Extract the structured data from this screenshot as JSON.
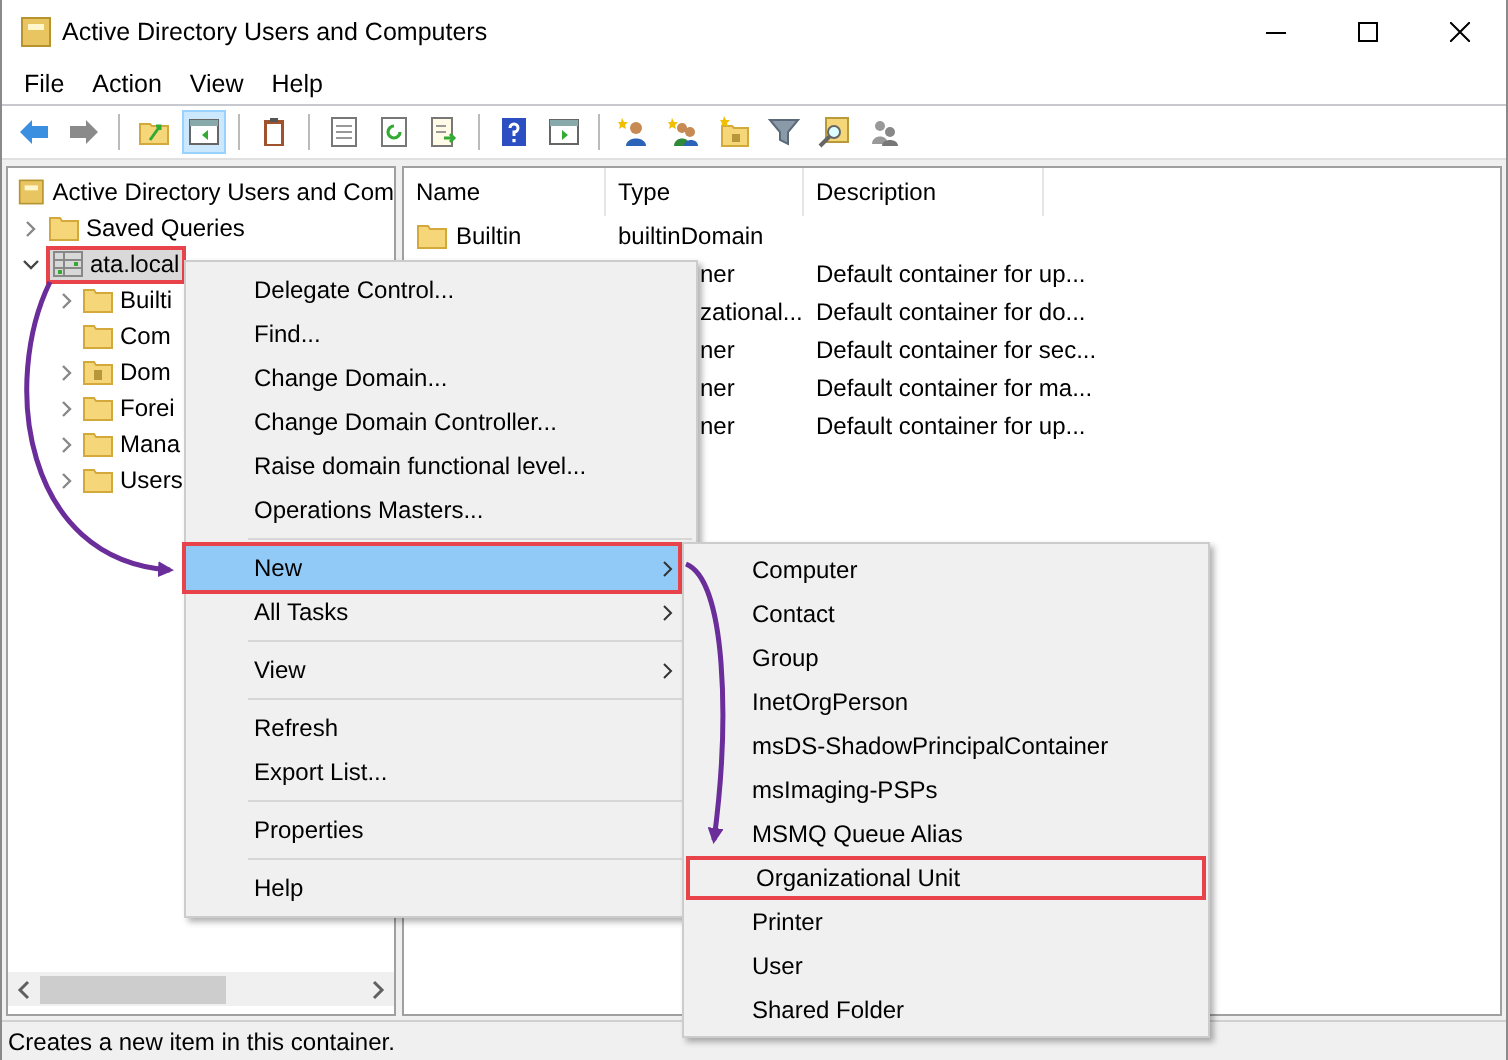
{
  "window": {
    "title": "Active Directory Users and Computers"
  },
  "menu_bar": [
    "File",
    "Action",
    "View",
    "Help"
  ],
  "toolbar": [
    {
      "kind": "back",
      "pressed": false
    },
    {
      "kind": "forward",
      "pressed": false
    },
    {
      "kind": "sep"
    },
    {
      "kind": "up",
      "pressed": false
    },
    {
      "kind": "tree",
      "pressed": true
    },
    {
      "kind": "sep"
    },
    {
      "kind": "clipboard",
      "pressed": false
    },
    {
      "kind": "sep"
    },
    {
      "kind": "properties",
      "pressed": false
    },
    {
      "kind": "refresh",
      "pressed": false
    },
    {
      "kind": "export",
      "pressed": false
    },
    {
      "kind": "sep"
    },
    {
      "kind": "help",
      "pressed": false
    },
    {
      "kind": "action-pane",
      "pressed": false
    },
    {
      "kind": "sep"
    },
    {
      "kind": "new-user",
      "pressed": false
    },
    {
      "kind": "new-group",
      "pressed": false
    },
    {
      "kind": "new-ou",
      "pressed": false
    },
    {
      "kind": "filter",
      "pressed": false
    },
    {
      "kind": "find",
      "pressed": false
    },
    {
      "kind": "delegate",
      "pressed": false
    }
  ],
  "tree": {
    "root": "Active Directory Users and Com",
    "items": [
      {
        "label": "Saved Queries",
        "kind": "folder",
        "expanded": false,
        "expandable": true,
        "highlighted": false
      },
      {
        "label": "ata.local",
        "kind": "domain",
        "expanded": true,
        "expandable": true,
        "highlighted": true,
        "children": [
          {
            "label": "Builti",
            "kind": "folder",
            "expandable": true
          },
          {
            "label": "Com",
            "kind": "folder",
            "expandable": false
          },
          {
            "label": "Dom",
            "kind": "ou",
            "expandable": true
          },
          {
            "label": "Forei",
            "kind": "folder",
            "expandable": true
          },
          {
            "label": "Mana",
            "kind": "folder",
            "expandable": true
          },
          {
            "label": "Users",
            "kind": "folder",
            "expandable": true
          }
        ]
      }
    ]
  },
  "list": {
    "columns": [
      "Name",
      "Type",
      "Description"
    ],
    "rows": [
      {
        "name": "Builtin",
        "type": "builtinDomain"
      },
      {
        "type": "ner",
        "description": "Default container for up..."
      },
      {
        "type": "zational...",
        "description": "Default container for do..."
      },
      {
        "type": "ner",
        "description": "Default container for sec..."
      },
      {
        "type": "ner",
        "description": "Default container for ma..."
      },
      {
        "type": "ner",
        "description": "Default container for up..."
      }
    ]
  },
  "context_menu": [
    {
      "kind": "item",
      "label": "Delegate Control..."
    },
    {
      "kind": "item",
      "label": "Find..."
    },
    {
      "kind": "item",
      "label": "Change Domain..."
    },
    {
      "kind": "item",
      "label": "Change Domain Controller..."
    },
    {
      "kind": "item",
      "label": "Raise domain functional level..."
    },
    {
      "kind": "item",
      "label": "Operations Masters..."
    },
    {
      "kind": "separator"
    },
    {
      "kind": "item",
      "label": "New",
      "submenu": true,
      "selected": true,
      "highlighted": true
    },
    {
      "kind": "item",
      "label": "All Tasks",
      "submenu": true,
      "selected": false,
      "highlighted": false
    },
    {
      "kind": "separator"
    },
    {
      "kind": "item",
      "label": "View",
      "submenu": true,
      "selected": false,
      "highlighted": false
    },
    {
      "kind": "separator"
    },
    {
      "kind": "item",
      "label": "Refresh"
    },
    {
      "kind": "item",
      "label": "Export List..."
    },
    {
      "kind": "separator"
    },
    {
      "kind": "item",
      "label": "Properties"
    },
    {
      "kind": "separator"
    },
    {
      "kind": "item",
      "label": "Help"
    }
  ],
  "submenu": [
    {
      "label": "Computer",
      "highlighted": false
    },
    {
      "label": "Contact",
      "highlighted": false
    },
    {
      "label": "Group",
      "highlighted": false
    },
    {
      "label": "InetOrgPerson",
      "highlighted": false
    },
    {
      "label": "msDS-ShadowPrincipalContainer",
      "highlighted": false
    },
    {
      "label": "msImaging-PSPs",
      "highlighted": false
    },
    {
      "label": "MSMQ Queue Alias",
      "highlighted": false
    },
    {
      "label": "Organizational Unit",
      "highlighted": true
    },
    {
      "label": "Printer",
      "highlighted": false
    },
    {
      "label": "User",
      "highlighted": false
    },
    {
      "label": "Shared Folder",
      "highlighted": false
    }
  ],
  "status_bar": "Creates a new item in this container."
}
